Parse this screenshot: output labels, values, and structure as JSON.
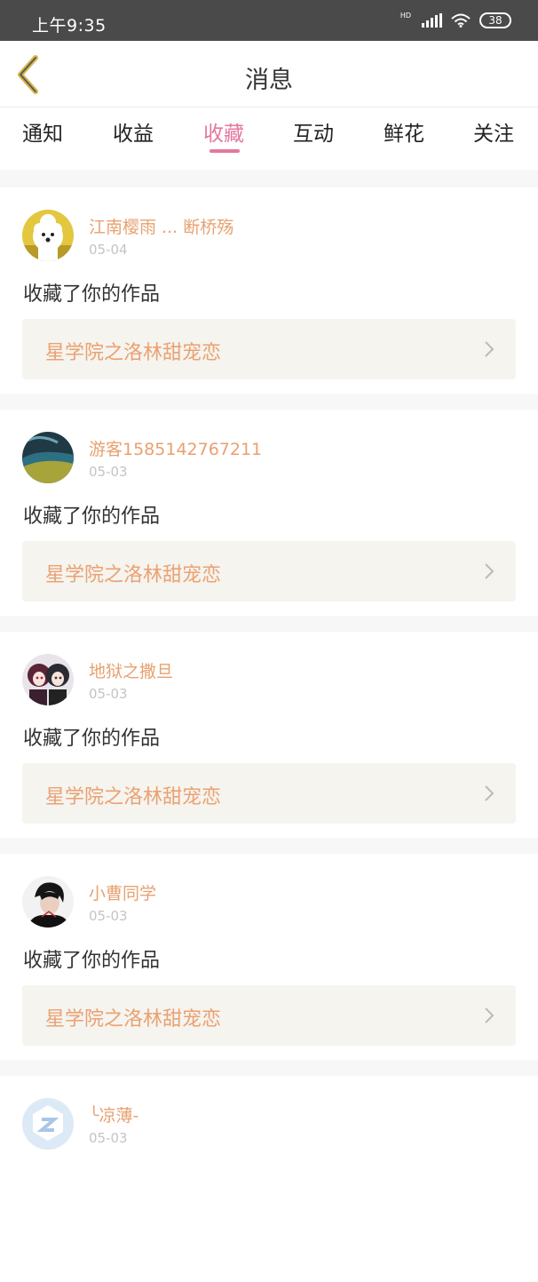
{
  "status_bar": {
    "time": "上午9:35",
    "network": "HD",
    "battery": "38"
  },
  "header": {
    "title": "消息"
  },
  "tabs": [
    {
      "label": "通知"
    },
    {
      "label": "收益"
    },
    {
      "label": "收藏",
      "active": true
    },
    {
      "label": "互动"
    },
    {
      "label": "鲜花"
    },
    {
      "label": "关注"
    }
  ],
  "messages": [
    {
      "user": "江南樱雨 ... 断桥殇",
      "date": "05-04",
      "action": "收藏了你的作品",
      "work": "星学院之洛林甜宠恋",
      "avatar": "dog-avatar"
    },
    {
      "user": "游客1585142767211",
      "date": "05-03",
      "action": "收藏了你的作品",
      "work": "星学院之洛林甜宠恋",
      "avatar": "landscape-avatar"
    },
    {
      "user": "地狱之撒旦",
      "date": "05-03",
      "action": "收藏了你的作品",
      "work": "星学院之洛林甜宠恋",
      "avatar": "anime-avatar"
    },
    {
      "user": "小曹同学",
      "date": "05-03",
      "action": "收藏了你的作品",
      "work": "星学院之洛林甜宠恋",
      "avatar": "boy-avatar"
    },
    {
      "user": "╰凉薄-",
      "date": "05-03",
      "action": "",
      "work": "",
      "avatar": "default-avatar"
    }
  ],
  "colors": {
    "accent": "#e4789f",
    "username": "#e7a170",
    "work_bg": "#f5f4ee",
    "back_arrow": "#d7b74a"
  }
}
